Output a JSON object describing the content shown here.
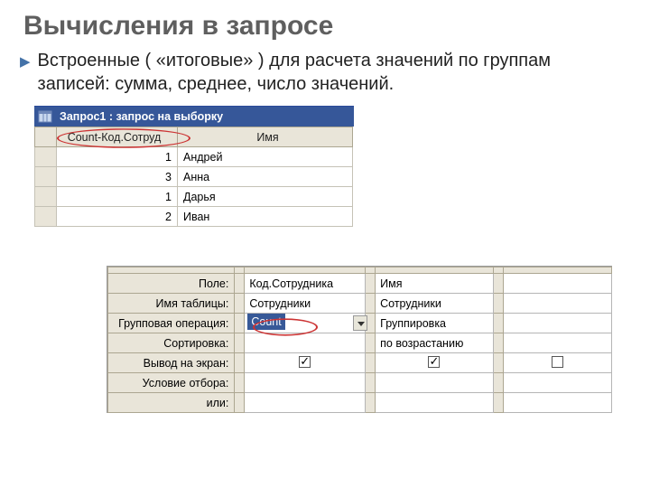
{
  "title": "Вычисления в запросе",
  "bullet": "Встроенные ( «итоговые» ) для расчета значений по группам записей: сумма, среднее, число значений.",
  "datasheet": {
    "window_title": "Запрос1 : запрос на выборку",
    "columns": [
      "Count-Код.Сотруд",
      "Имя"
    ],
    "rows": [
      {
        "count": 1,
        "name": "Андрей"
      },
      {
        "count": 3,
        "name": "Анна"
      },
      {
        "count": 1,
        "name": "Дарья"
      },
      {
        "count": 2,
        "name": "Иван"
      }
    ]
  },
  "design": {
    "labels": {
      "field": "Поле:",
      "table": "Имя таблицы:",
      "group_op": "Групповая операция:",
      "sort": "Сортировка:",
      "show": "Вывод на экран:",
      "criteria": "Условие отбора:",
      "or": "или:"
    },
    "col1": {
      "field": "Код.Сотрудника",
      "table": "Сотрудники",
      "group_op": "Count",
      "sort": "",
      "show": true,
      "criteria": "",
      "or": ""
    },
    "col2": {
      "field": "Имя",
      "table": "Сотрудники",
      "group_op": "Группировка",
      "sort": "по возрастанию",
      "show": true,
      "criteria": "",
      "or": ""
    }
  }
}
